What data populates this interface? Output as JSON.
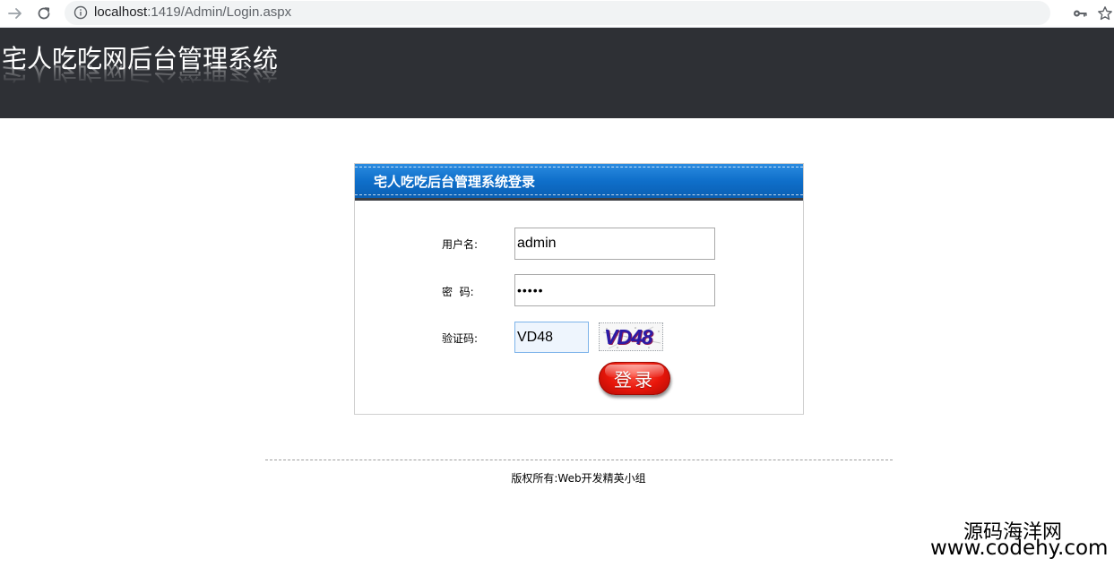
{
  "browser": {
    "url_host": "localhost",
    "url_path": ":1419/Admin/Login.aspx"
  },
  "header": {
    "site_title": "宅人吃吃网后台管理系统"
  },
  "login": {
    "title": "宅人吃吃后台管理系统登录",
    "username_label": "用户名:",
    "username_value": "admin",
    "password_label": "密  码:",
    "password_value": "admin",
    "captcha_label": "验证码:",
    "captcha_value": "VD48",
    "captcha_image_text": "VD48",
    "submit_label": "登录"
  },
  "footer": {
    "copyright": "版权所有:Web开发精英小组"
  },
  "watermark": {
    "line1": "源码海洋网",
    "line2": "www.codehy.com"
  },
  "colors": {
    "header_bg": "#2e3035",
    "panel_header_blue": "#0f6fca",
    "button_red": "#e8160a"
  },
  "icons": {
    "back": "arrow-right-icon",
    "reload": "reload-icon",
    "info": "info-icon",
    "key": "key-icon",
    "star": "star-icon"
  }
}
